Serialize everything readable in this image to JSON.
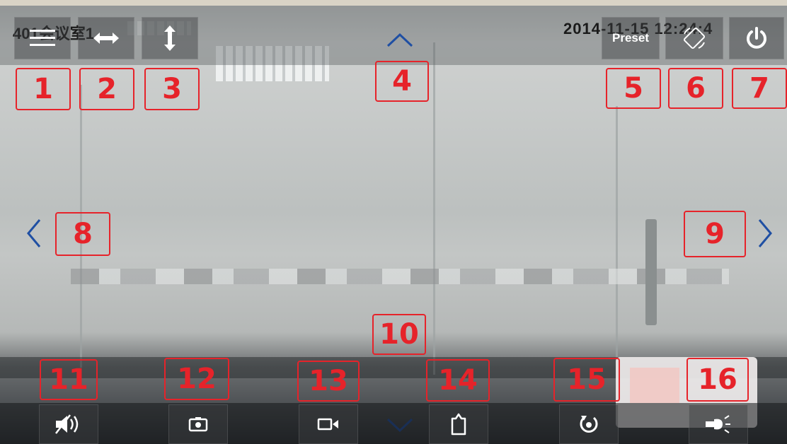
{
  "header": {
    "title": "401会议室1",
    "timestamp": "2014-11-15 12:24:4",
    "preset_label": "Preset"
  },
  "callouts": [
    "1",
    "2",
    "3",
    "4",
    "5",
    "6",
    "7",
    "8",
    "9",
    "10",
    "11",
    "12",
    "13",
    "14",
    "15",
    "16"
  ],
  "icons": {
    "menu": "menu-icon",
    "horizontal_flip": "horizontal-flip-icon",
    "vertical_flip": "vertical-flip-icon",
    "rotate_screen": "rotate-screen-icon",
    "power": "power-icon",
    "mute": "speaker-mute-icon",
    "snapshot": "camera-icon",
    "record": "video-record-icon",
    "album": "album-icon",
    "reset": "reset-icon",
    "light": "light-bulb-icon"
  },
  "colors": {
    "callout": "#e6232a",
    "ptz_arrow": "#1f4fa3"
  }
}
